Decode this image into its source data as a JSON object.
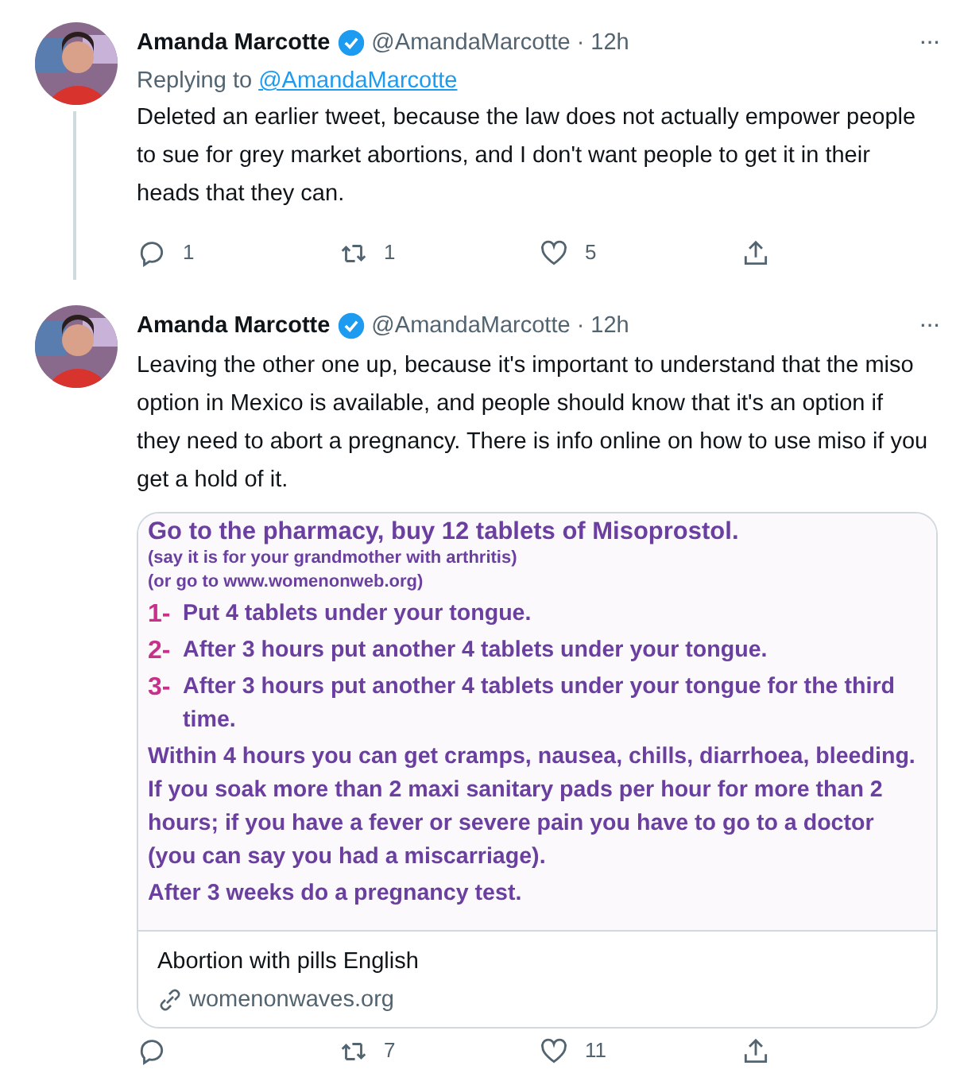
{
  "tweets": [
    {
      "author": "Amanda Marcotte",
      "verified": true,
      "handle": "@AmandaMarcotte",
      "time": "· 12h",
      "more": "···",
      "thread_line": true,
      "replying_to": {
        "prefix": "Replying to",
        "handle": "@AmandaMarcotte"
      },
      "text": "Deleted an earlier tweet, because the law does not actually empower people to sue for grey market abortions, and I don't want people to get it in their heads that they can.",
      "actions": [
        {
          "kind": "reply",
          "count": "1"
        },
        {
          "kind": "retweet",
          "count": "1"
        },
        {
          "kind": "like",
          "count": "5"
        },
        {
          "kind": "share"
        }
      ]
    },
    {
      "author": "Amanda Marcotte",
      "verified": true,
      "handle": "@AmandaMarcotte",
      "time": "· 12h",
      "more": "···",
      "thread_line": false,
      "text": "Leaving the other one up, because it's important to understand that the miso option in Mexico is available, and people should know that it's an option if they need to abort a pregnancy. There is info online on how to use miso if you get a hold of it.",
      "card": {
        "lines": [
          {
            "kind": "heading",
            "text": "Go to the pharmacy, buy 12 tablets of Misoprostol."
          },
          {
            "kind": "note",
            "text": "(say it is for your grandmother with arthritis)"
          },
          {
            "kind": "note",
            "text": "(or go to www.womenonweb.org)"
          },
          {
            "kind": "step",
            "number": "1-",
            "text": "Put 4 tablets under your tongue."
          },
          {
            "kind": "step",
            "number": "2-",
            "text": "After 3 hours put another 4 tablets under your tongue."
          },
          {
            "kind": "step",
            "number": "3-",
            "text": "After 3 hours put another 4 tablets under your tongue for the third time."
          },
          {
            "kind": "body",
            "text": "Within 4 hours you can get cramps, nausea, chills, diarrhoea, bleeding. If you soak more than 2 maxi sanitary pads per hour for more than 2 hours; if you have a fever or severe pain you have to go to a doctor (you can say you had a miscarriage)."
          },
          {
            "kind": "body",
            "text": "After 3 weeks do a pregnancy test."
          }
        ],
        "title": "Abortion with pills English",
        "domain": "womenonwaves.org"
      },
      "actions": [
        {
          "kind": "reply"
        },
        {
          "kind": "retweet",
          "count": "7"
        },
        {
          "kind": "like",
          "count": "11"
        },
        {
          "kind": "share"
        }
      ]
    }
  ]
}
